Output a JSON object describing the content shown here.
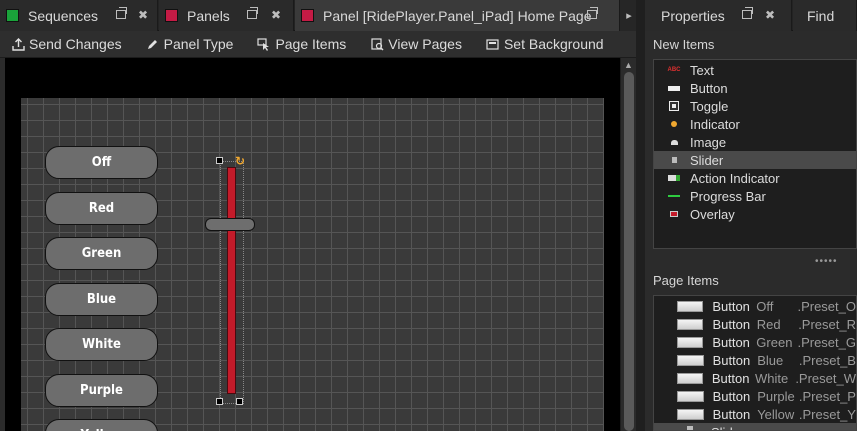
{
  "tabs": [
    {
      "label": "Sequences",
      "color": "#1aa33a"
    },
    {
      "label": "Panels",
      "color": "#c41b45"
    },
    {
      "label": "Panel [RidePlayer.Panel_iPad] Home Page",
      "color": "#c41b45"
    }
  ],
  "right_tabs": [
    {
      "label": "Properties"
    },
    {
      "label": "Find"
    }
  ],
  "tab_overflow_glyph": "▸",
  "toolbar": {
    "send_changes": "Send Changes",
    "panel_type": "Panel Type",
    "page_items": "Page Items",
    "view_pages": "View Pages",
    "set_background": "Set Background"
  },
  "canvas": {
    "buttons": [
      "Off",
      "Red",
      "Green",
      "Blue",
      "White",
      "Purple",
      "Yellow"
    ]
  },
  "new_items": {
    "title": "New Items",
    "items": [
      {
        "label": "Text",
        "icon": "text-icon"
      },
      {
        "label": "Button",
        "icon": "button-icon"
      },
      {
        "label": "Toggle",
        "icon": "toggle-icon"
      },
      {
        "label": "Indicator",
        "icon": "indicator-icon"
      },
      {
        "label": "Image",
        "icon": "image-icon"
      },
      {
        "label": "Slider",
        "icon": "slider-icon",
        "selected": true
      },
      {
        "label": "Action Indicator",
        "icon": "action-indicator-icon"
      },
      {
        "label": "Progress Bar",
        "icon": "progress-bar-icon"
      },
      {
        "label": "Overlay",
        "icon": "overlay-icon"
      }
    ]
  },
  "page_items": {
    "title": "Page Items",
    "rows": [
      {
        "type": "Button",
        "name": "Off",
        "preset": ".Preset_O"
      },
      {
        "type": "Button",
        "name": "Red",
        "preset": ".Preset_R"
      },
      {
        "type": "Button",
        "name": "Green",
        "preset": ".Preset_G"
      },
      {
        "type": "Button",
        "name": "Blue",
        "preset": ".Preset_B"
      },
      {
        "type": "Button",
        "name": "White",
        "preset": ".Preset_W"
      },
      {
        "type": "Button",
        "name": "Purple",
        "preset": ".Preset_P"
      },
      {
        "type": "Button",
        "name": "Yellow",
        "preset": ".Preset_Y"
      },
      {
        "type": "Slider",
        "name": "",
        "preset": "",
        "selected": true
      }
    ]
  },
  "colors": {
    "slider_fill": "#c41b2a",
    "selection": "#4a4a4a"
  }
}
